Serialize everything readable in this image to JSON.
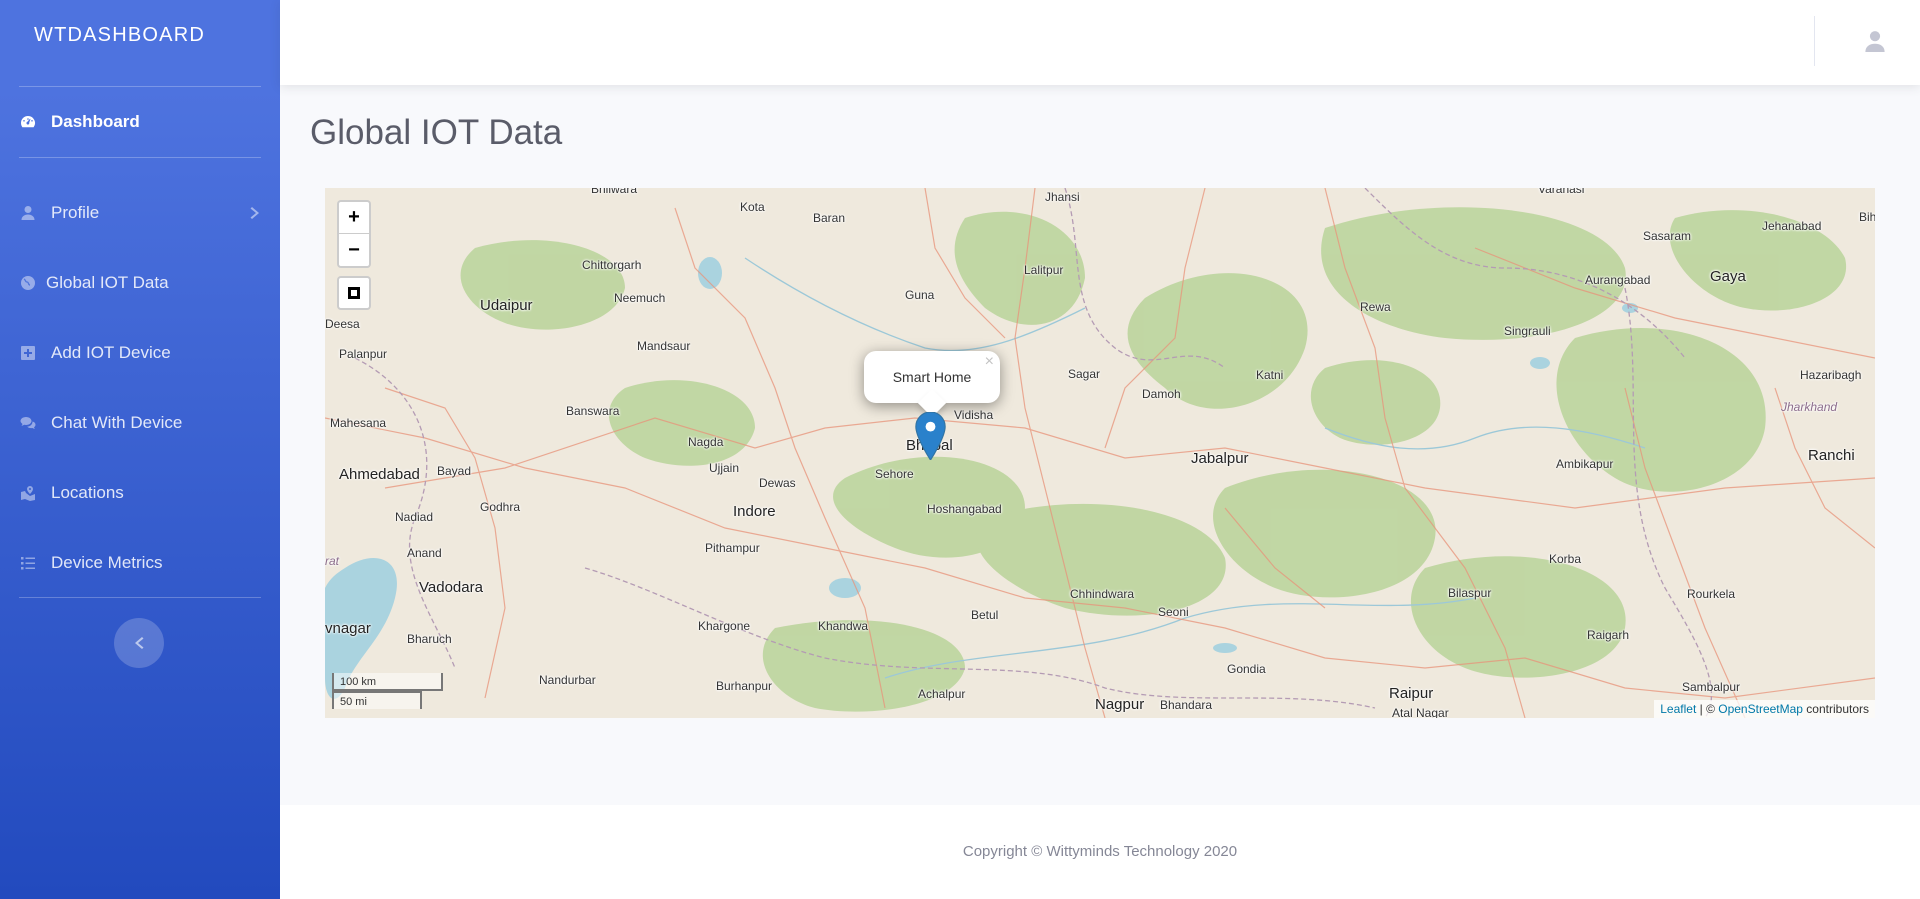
{
  "sidebar": {
    "brand": "WTDASHBOARD",
    "items": [
      {
        "label": "Dashboard",
        "icon": "tachometer-icon"
      },
      {
        "label": "Profile",
        "icon": "user-icon"
      },
      {
        "label": "Global IOT Data",
        "icon": "globe-icon"
      },
      {
        "label": "Add IOT Device",
        "icon": "plus-square-icon"
      },
      {
        "label": "Chat With Device",
        "icon": "comments-icon"
      },
      {
        "label": "Locations",
        "icon": "map-marked-icon"
      },
      {
        "label": "Device Metrics",
        "icon": "list-icon"
      }
    ],
    "toggle_icon": "chevron-left-icon"
  },
  "topbar": {
    "user_icon": "user-icon"
  },
  "page": {
    "title": "Global IOT Data"
  },
  "map": {
    "zoom_in": "+",
    "zoom_out": "−",
    "popup": {
      "text": "Smart Home",
      "close": "×"
    },
    "marker_color": "#2a81cb",
    "scale": {
      "km": "100 km",
      "mi": "50 mi"
    },
    "attribution": {
      "leaflet": "Leaflet",
      "sep": " | © ",
      "osm": "OpenStreetMap",
      "suffix": " contributors"
    },
    "places": [
      {
        "name": "Bhilwara"
      },
      {
        "name": "Kota"
      },
      {
        "name": "Baran"
      },
      {
        "name": "Jhansi"
      },
      {
        "name": "Varanasi"
      },
      {
        "name": "Jehanabad"
      },
      {
        "name": "Sasaram"
      },
      {
        "name": "Bih"
      },
      {
        "name": "Chittorgarh"
      },
      {
        "name": "Lalitpur"
      },
      {
        "name": "Aurangabad"
      },
      {
        "name": "Gaya"
      },
      {
        "name": "Udaipur"
      },
      {
        "name": "Neemuch"
      },
      {
        "name": "Guna"
      },
      {
        "name": "Rewa"
      },
      {
        "name": "Deesa"
      },
      {
        "name": "Singrauli"
      },
      {
        "name": "Palanpur"
      },
      {
        "name": "Mandsaur"
      },
      {
        "name": "Sagar"
      },
      {
        "name": "Katni"
      },
      {
        "name": "Hazaribagh"
      },
      {
        "name": "Damoh"
      },
      {
        "name": "Jharkhand"
      },
      {
        "name": "Banswara"
      },
      {
        "name": "Vidisha"
      },
      {
        "name": "Mahesana"
      },
      {
        "name": "Nagda"
      },
      {
        "name": "Bhopal"
      },
      {
        "name": "Ranchi"
      },
      {
        "name": "Ahmedabad"
      },
      {
        "name": "Bayad"
      },
      {
        "name": "Ujjain"
      },
      {
        "name": "Sehore"
      },
      {
        "name": "Jabalpur"
      },
      {
        "name": "Ambikapur"
      },
      {
        "name": "Dewas"
      },
      {
        "name": "Godhra"
      },
      {
        "name": "Indore"
      },
      {
        "name": "Hoshangabad"
      },
      {
        "name": "Nadiad"
      },
      {
        "name": "Pithampur"
      },
      {
        "name": "Anand"
      },
      {
        "name": "Korba"
      },
      {
        "name": "Chhindwara"
      },
      {
        "name": "Rourkela"
      },
      {
        "name": "Vadodara"
      },
      {
        "name": "Seoni"
      },
      {
        "name": "Bilaspur"
      },
      {
        "name": "Betul"
      },
      {
        "name": "vnagar"
      },
      {
        "name": "Khargone"
      },
      {
        "name": "Khandwa"
      },
      {
        "name": "Raigarh"
      },
      {
        "name": "Bharuch"
      },
      {
        "name": "Gondia"
      },
      {
        "name": "Nandurbar"
      },
      {
        "name": "Burhanpur"
      },
      {
        "name": "Sambalpur"
      },
      {
        "name": "Achalpur"
      },
      {
        "name": "Raipur"
      },
      {
        "name": "Nagpur"
      },
      {
        "name": "Bhandara"
      },
      {
        "name": "Atal Nagar"
      },
      {
        "name": "rat"
      }
    ]
  },
  "footer": {
    "copyright": "Copyright © Wittyminds Technology 2020"
  }
}
